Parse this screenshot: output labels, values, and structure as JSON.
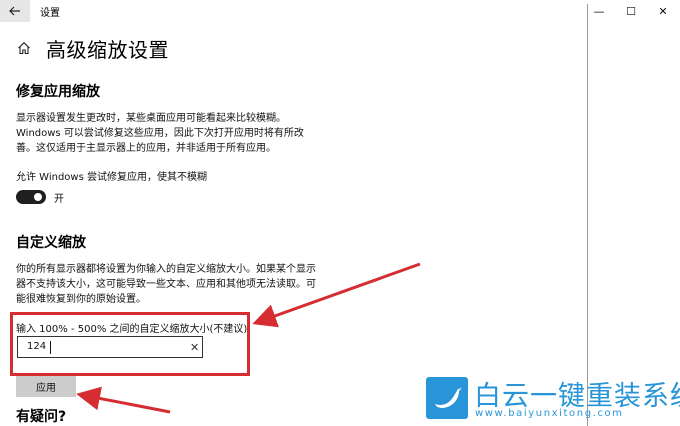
{
  "window": {
    "title": "设置",
    "minimize": "—",
    "maximize": "☐",
    "close": "✕"
  },
  "page": {
    "title": "高级缩放设置"
  },
  "fix_apps": {
    "title": "修复应用缩放",
    "description": "显示器设置发生更改时，某些桌面应用可能看起来比较模糊。Windows 可以尝试修复这些应用，因此下次打开应用时将有所改善。这仅适用于主显示器上的应用，并非适用于所有应用。",
    "toggle_label": "允许 Windows 尝试修复应用，使其不模糊",
    "toggle_state": "开"
  },
  "custom_scaling": {
    "title": "自定义缩放",
    "description": "你的所有显示器都将设置为你输入的自定义缩放大小。如果某个显示器不支持该大小，这可能导致一些文本、应用和其他项无法读取。可能很难恢复到你的原始设置。",
    "input_label": "输入 100% - 500% 之间的自定义缩放大小(不建议)",
    "input_value": "124",
    "clear": "✕",
    "apply_label": "应用"
  },
  "help": {
    "title": "有疑问?"
  },
  "watermark": {
    "name": "白云一键重装系统",
    "url": "www.baiyunxitong.com",
    "color": "#2795d8"
  },
  "annotation_color": "#d62d33"
}
